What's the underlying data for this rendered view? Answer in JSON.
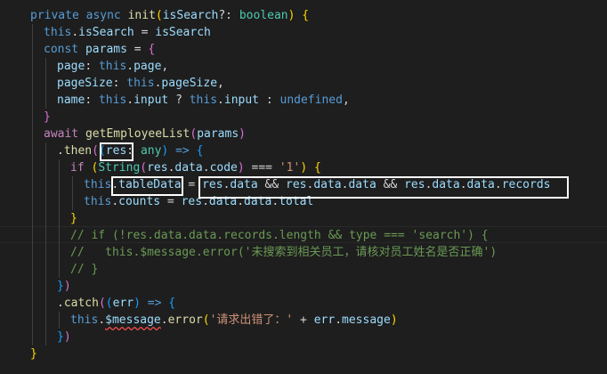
{
  "editor": {
    "lines": [
      {
        "indent": 0,
        "tokens": [
          {
            "t": "private ",
            "c": "kw"
          },
          {
            "t": "async ",
            "c": "kw"
          },
          {
            "t": "init",
            "c": "fn"
          },
          {
            "t": "(",
            "c": "b1"
          },
          {
            "t": "isSearch",
            "c": "var"
          },
          {
            "t": "?: ",
            "c": "op"
          },
          {
            "t": "boolean",
            "c": "type"
          },
          {
            "t": ")",
            "c": "b1"
          },
          {
            "t": " {",
            "c": "b1"
          }
        ]
      },
      {
        "indent": 1,
        "tokens": [
          {
            "t": "this",
            "c": "kw"
          },
          {
            "t": ".",
            "c": "op"
          },
          {
            "t": "isSearch",
            "c": "var"
          },
          {
            "t": " = ",
            "c": "op"
          },
          {
            "t": "isSearch",
            "c": "var"
          }
        ]
      },
      {
        "indent": 1,
        "tokens": [
          {
            "t": "const ",
            "c": "kw"
          },
          {
            "t": "params",
            "c": "var"
          },
          {
            "t": " = ",
            "c": "op"
          },
          {
            "t": "{",
            "c": "b2"
          }
        ]
      },
      {
        "indent": 2,
        "tokens": [
          {
            "t": "page",
            "c": "var"
          },
          {
            "t": ": ",
            "c": "op"
          },
          {
            "t": "this",
            "c": "kw"
          },
          {
            "t": ".",
            "c": "op"
          },
          {
            "t": "page",
            "c": "var"
          },
          {
            "t": ",",
            "c": "op"
          }
        ]
      },
      {
        "indent": 2,
        "tokens": [
          {
            "t": "pageSize",
            "c": "var"
          },
          {
            "t": ": ",
            "c": "op"
          },
          {
            "t": "this",
            "c": "kw"
          },
          {
            "t": ".",
            "c": "op"
          },
          {
            "t": "pageSize",
            "c": "var"
          },
          {
            "t": ",",
            "c": "op"
          }
        ]
      },
      {
        "indent": 2,
        "tokens": [
          {
            "t": "name",
            "c": "var"
          },
          {
            "t": ": ",
            "c": "op"
          },
          {
            "t": "this",
            "c": "kw"
          },
          {
            "t": ".",
            "c": "op"
          },
          {
            "t": "input",
            "c": "var"
          },
          {
            "t": " ? ",
            "c": "op"
          },
          {
            "t": "this",
            "c": "kw"
          },
          {
            "t": ".",
            "c": "op"
          },
          {
            "t": "input",
            "c": "var"
          },
          {
            "t": " : ",
            "c": "op"
          },
          {
            "t": "undefined",
            "c": "kw"
          },
          {
            "t": ",",
            "c": "op"
          }
        ]
      },
      {
        "indent": 1,
        "tokens": [
          {
            "t": "}",
            "c": "b2"
          }
        ]
      },
      {
        "indent": 1,
        "tokens": [
          {
            "t": "await ",
            "c": "ctl"
          },
          {
            "t": "getEmployeeList",
            "c": "fn"
          },
          {
            "t": "(",
            "c": "b2"
          },
          {
            "t": "params",
            "c": "var"
          },
          {
            "t": ")",
            "c": "b2"
          }
        ]
      },
      {
        "indent": 2,
        "tokens": [
          {
            "t": ".",
            "c": "op"
          },
          {
            "t": "then",
            "c": "fn"
          },
          {
            "t": "(",
            "c": "b2"
          },
          {
            "t": "(",
            "c": "b3"
          },
          {
            "t": "res",
            "c": "var"
          },
          {
            "t": ": ",
            "c": "op"
          },
          {
            "t": "any",
            "c": "type"
          },
          {
            "t": ")",
            "c": "b3"
          },
          {
            "t": " => ",
            "c": "kw"
          },
          {
            "t": "{",
            "c": "b3"
          }
        ]
      },
      {
        "indent": 3,
        "tokens": [
          {
            "t": "if ",
            "c": "ctl"
          },
          {
            "t": "(",
            "c": "b1"
          },
          {
            "t": "String",
            "c": "type"
          },
          {
            "t": "(",
            "c": "b2"
          },
          {
            "t": "res",
            "c": "var"
          },
          {
            "t": ".",
            "c": "op"
          },
          {
            "t": "data",
            "c": "var"
          },
          {
            "t": ".",
            "c": "op"
          },
          {
            "t": "code",
            "c": "var"
          },
          {
            "t": ")",
            "c": "b2"
          },
          {
            "t": " === ",
            "c": "op"
          },
          {
            "t": "'1'",
            "c": "str"
          },
          {
            "t": ")",
            "c": "b1"
          },
          {
            "t": " {",
            "c": "b1"
          }
        ]
      },
      {
        "indent": 4,
        "tokens": [
          {
            "t": "this",
            "c": "kw"
          },
          {
            "t": ".",
            "c": "op"
          },
          {
            "t": "tableData",
            "c": "var"
          },
          {
            "t": " = ",
            "c": "op"
          },
          {
            "t": "res",
            "c": "var"
          },
          {
            "t": ".",
            "c": "op"
          },
          {
            "t": "data",
            "c": "var"
          },
          {
            "t": " && ",
            "c": "op"
          },
          {
            "t": "res",
            "c": "var"
          },
          {
            "t": ".",
            "c": "op"
          },
          {
            "t": "data",
            "c": "var"
          },
          {
            "t": ".",
            "c": "op"
          },
          {
            "t": "data",
            "c": "var"
          },
          {
            "t": " && ",
            "c": "op"
          },
          {
            "t": "res",
            "c": "var"
          },
          {
            "t": ".",
            "c": "op"
          },
          {
            "t": "data",
            "c": "var"
          },
          {
            "t": ".",
            "c": "op"
          },
          {
            "t": "data",
            "c": "var"
          },
          {
            "t": ".",
            "c": "op"
          },
          {
            "t": "records",
            "c": "var"
          }
        ]
      },
      {
        "indent": 4,
        "tokens": [
          {
            "t": "this",
            "c": "kw"
          },
          {
            "t": ".",
            "c": "op"
          },
          {
            "t": "counts",
            "c": "var"
          },
          {
            "t": " = ",
            "c": "op"
          },
          {
            "t": "res",
            "c": "var"
          },
          {
            "t": ".",
            "c": "op"
          },
          {
            "t": "data",
            "c": "var"
          },
          {
            "t": ".",
            "c": "op"
          },
          {
            "t": "data",
            "c": "var"
          },
          {
            "t": ".",
            "c": "op"
          },
          {
            "t": "total",
            "c": "var"
          }
        ]
      },
      {
        "indent": 3,
        "tokens": [
          {
            "t": "}",
            "c": "b1"
          }
        ]
      },
      {
        "indent": 3,
        "tokens": [
          {
            "t": "// if (!res.data.data.records.length && type === 'search') {",
            "c": "com"
          }
        ]
      },
      {
        "indent": 3,
        "tokens": [
          {
            "t": "//   this.$message.error('未搜索到相关员工，请核对员工姓名是否正确')",
            "c": "com"
          }
        ]
      },
      {
        "indent": 3,
        "tokens": [
          {
            "t": "// }",
            "c": "com"
          }
        ]
      },
      {
        "indent": 2,
        "tokens": [
          {
            "t": "}",
            "c": "b3"
          },
          {
            "t": ")",
            "c": "b2"
          }
        ]
      },
      {
        "indent": 2,
        "tokens": [
          {
            "t": ".",
            "c": "op"
          },
          {
            "t": "catch",
            "c": "fn"
          },
          {
            "t": "(",
            "c": "b2"
          },
          {
            "t": "(",
            "c": "b3"
          },
          {
            "t": "err",
            "c": "var"
          },
          {
            "t": ")",
            "c": "b3"
          },
          {
            "t": " => ",
            "c": "kw"
          },
          {
            "t": "{",
            "c": "b3"
          }
        ]
      },
      {
        "indent": 3,
        "tokens": [
          {
            "t": "this",
            "c": "kw"
          },
          {
            "t": ".",
            "c": "op"
          },
          {
            "t": "$message",
            "c": "var",
            "sq": true
          },
          {
            "t": ".",
            "c": "op"
          },
          {
            "t": "error",
            "c": "fn"
          },
          {
            "t": "(",
            "c": "b1"
          },
          {
            "t": "'请求出错了：' ",
            "c": "str"
          },
          {
            "t": "+ ",
            "c": "op"
          },
          {
            "t": "err",
            "c": "var"
          },
          {
            "t": ".",
            "c": "op"
          },
          {
            "t": "message",
            "c": "var"
          },
          {
            "t": ")",
            "c": "b1"
          }
        ]
      },
      {
        "indent": 2,
        "tokens": [
          {
            "t": "}",
            "c": "b3"
          },
          {
            "t": ")",
            "c": "b2"
          }
        ]
      },
      {
        "indent": 0,
        "tokens": [
          {
            "t": "}",
            "c": "b1"
          }
        ]
      }
    ],
    "colors": {
      "background": "#1e1e1e",
      "keyword": "#569cd6",
      "control": "#c586c0",
      "function": "#dcdcaa",
      "variable": "#9cdcfe",
      "type": "#4ec9b0",
      "string": "#ce9178",
      "comment": "#6a9955",
      "annotation_box": "#ffffff"
    }
  }
}
